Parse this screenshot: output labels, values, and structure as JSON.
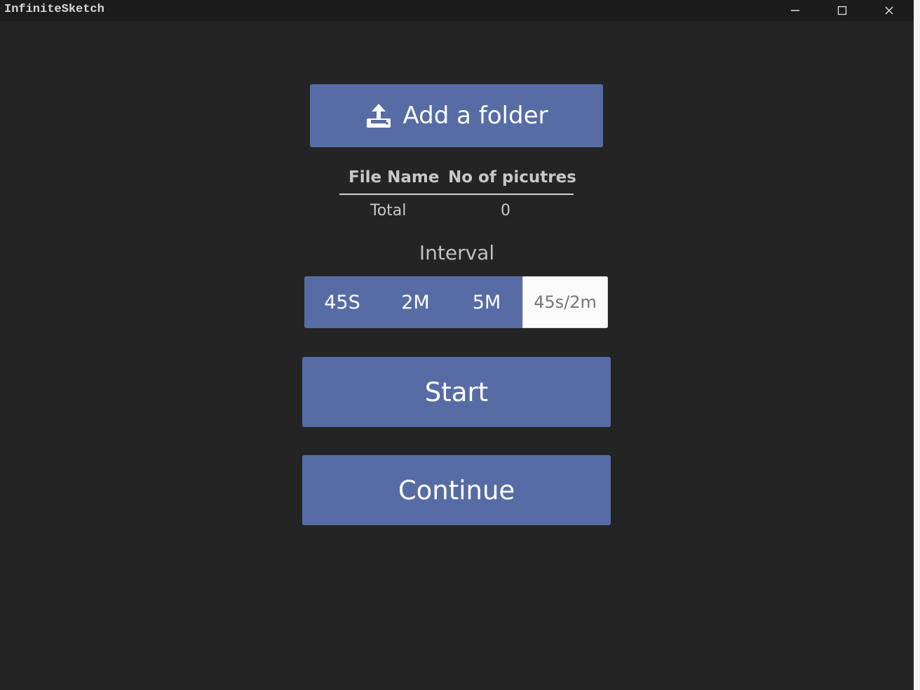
{
  "window": {
    "title": "InfiniteSketch",
    "controls": [
      "minimize-icon",
      "maximize-icon",
      "close-icon"
    ]
  },
  "add_folder": {
    "label": "Add a folder",
    "icon": "upload-icon"
  },
  "table": {
    "columns": [
      "File Name",
      "No of picutres"
    ],
    "total_label": "Total",
    "total_value": "0"
  },
  "interval": {
    "label": "Interval",
    "options": [
      "45S",
      "2M",
      "5M"
    ],
    "custom_placeholder": "45s/2m"
  },
  "actions": {
    "start_label": "Start",
    "continue_label": "Continue"
  },
  "colors": {
    "background": "#242424",
    "titlebar": "#1c1c1c",
    "accent": "#576ca4",
    "text": "#c8c8c8"
  }
}
